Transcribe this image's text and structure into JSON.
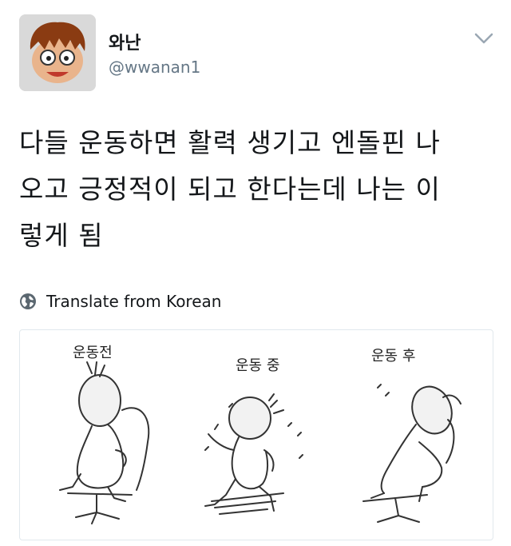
{
  "user": {
    "display_name": "와난",
    "handle": "@wwanan1"
  },
  "tweet": {
    "lines": [
      "다들 운동하면 활력 생기고 엔돌핀 나",
      "오고 긍정적이 되고 한다는데 나는 이",
      "렇게 됨"
    ]
  },
  "translate": {
    "label": "Translate from Korean"
  },
  "media": {
    "panels": [
      {
        "caption": "운동전"
      },
      {
        "caption": "운동 중"
      },
      {
        "caption": "운동 후"
      }
    ]
  },
  "icons": {
    "menu": "chevron-down-icon",
    "translate": "globe-icon"
  },
  "colors": {
    "text": "#14171a",
    "secondary": "#657786",
    "border": "#e1e8ed"
  }
}
